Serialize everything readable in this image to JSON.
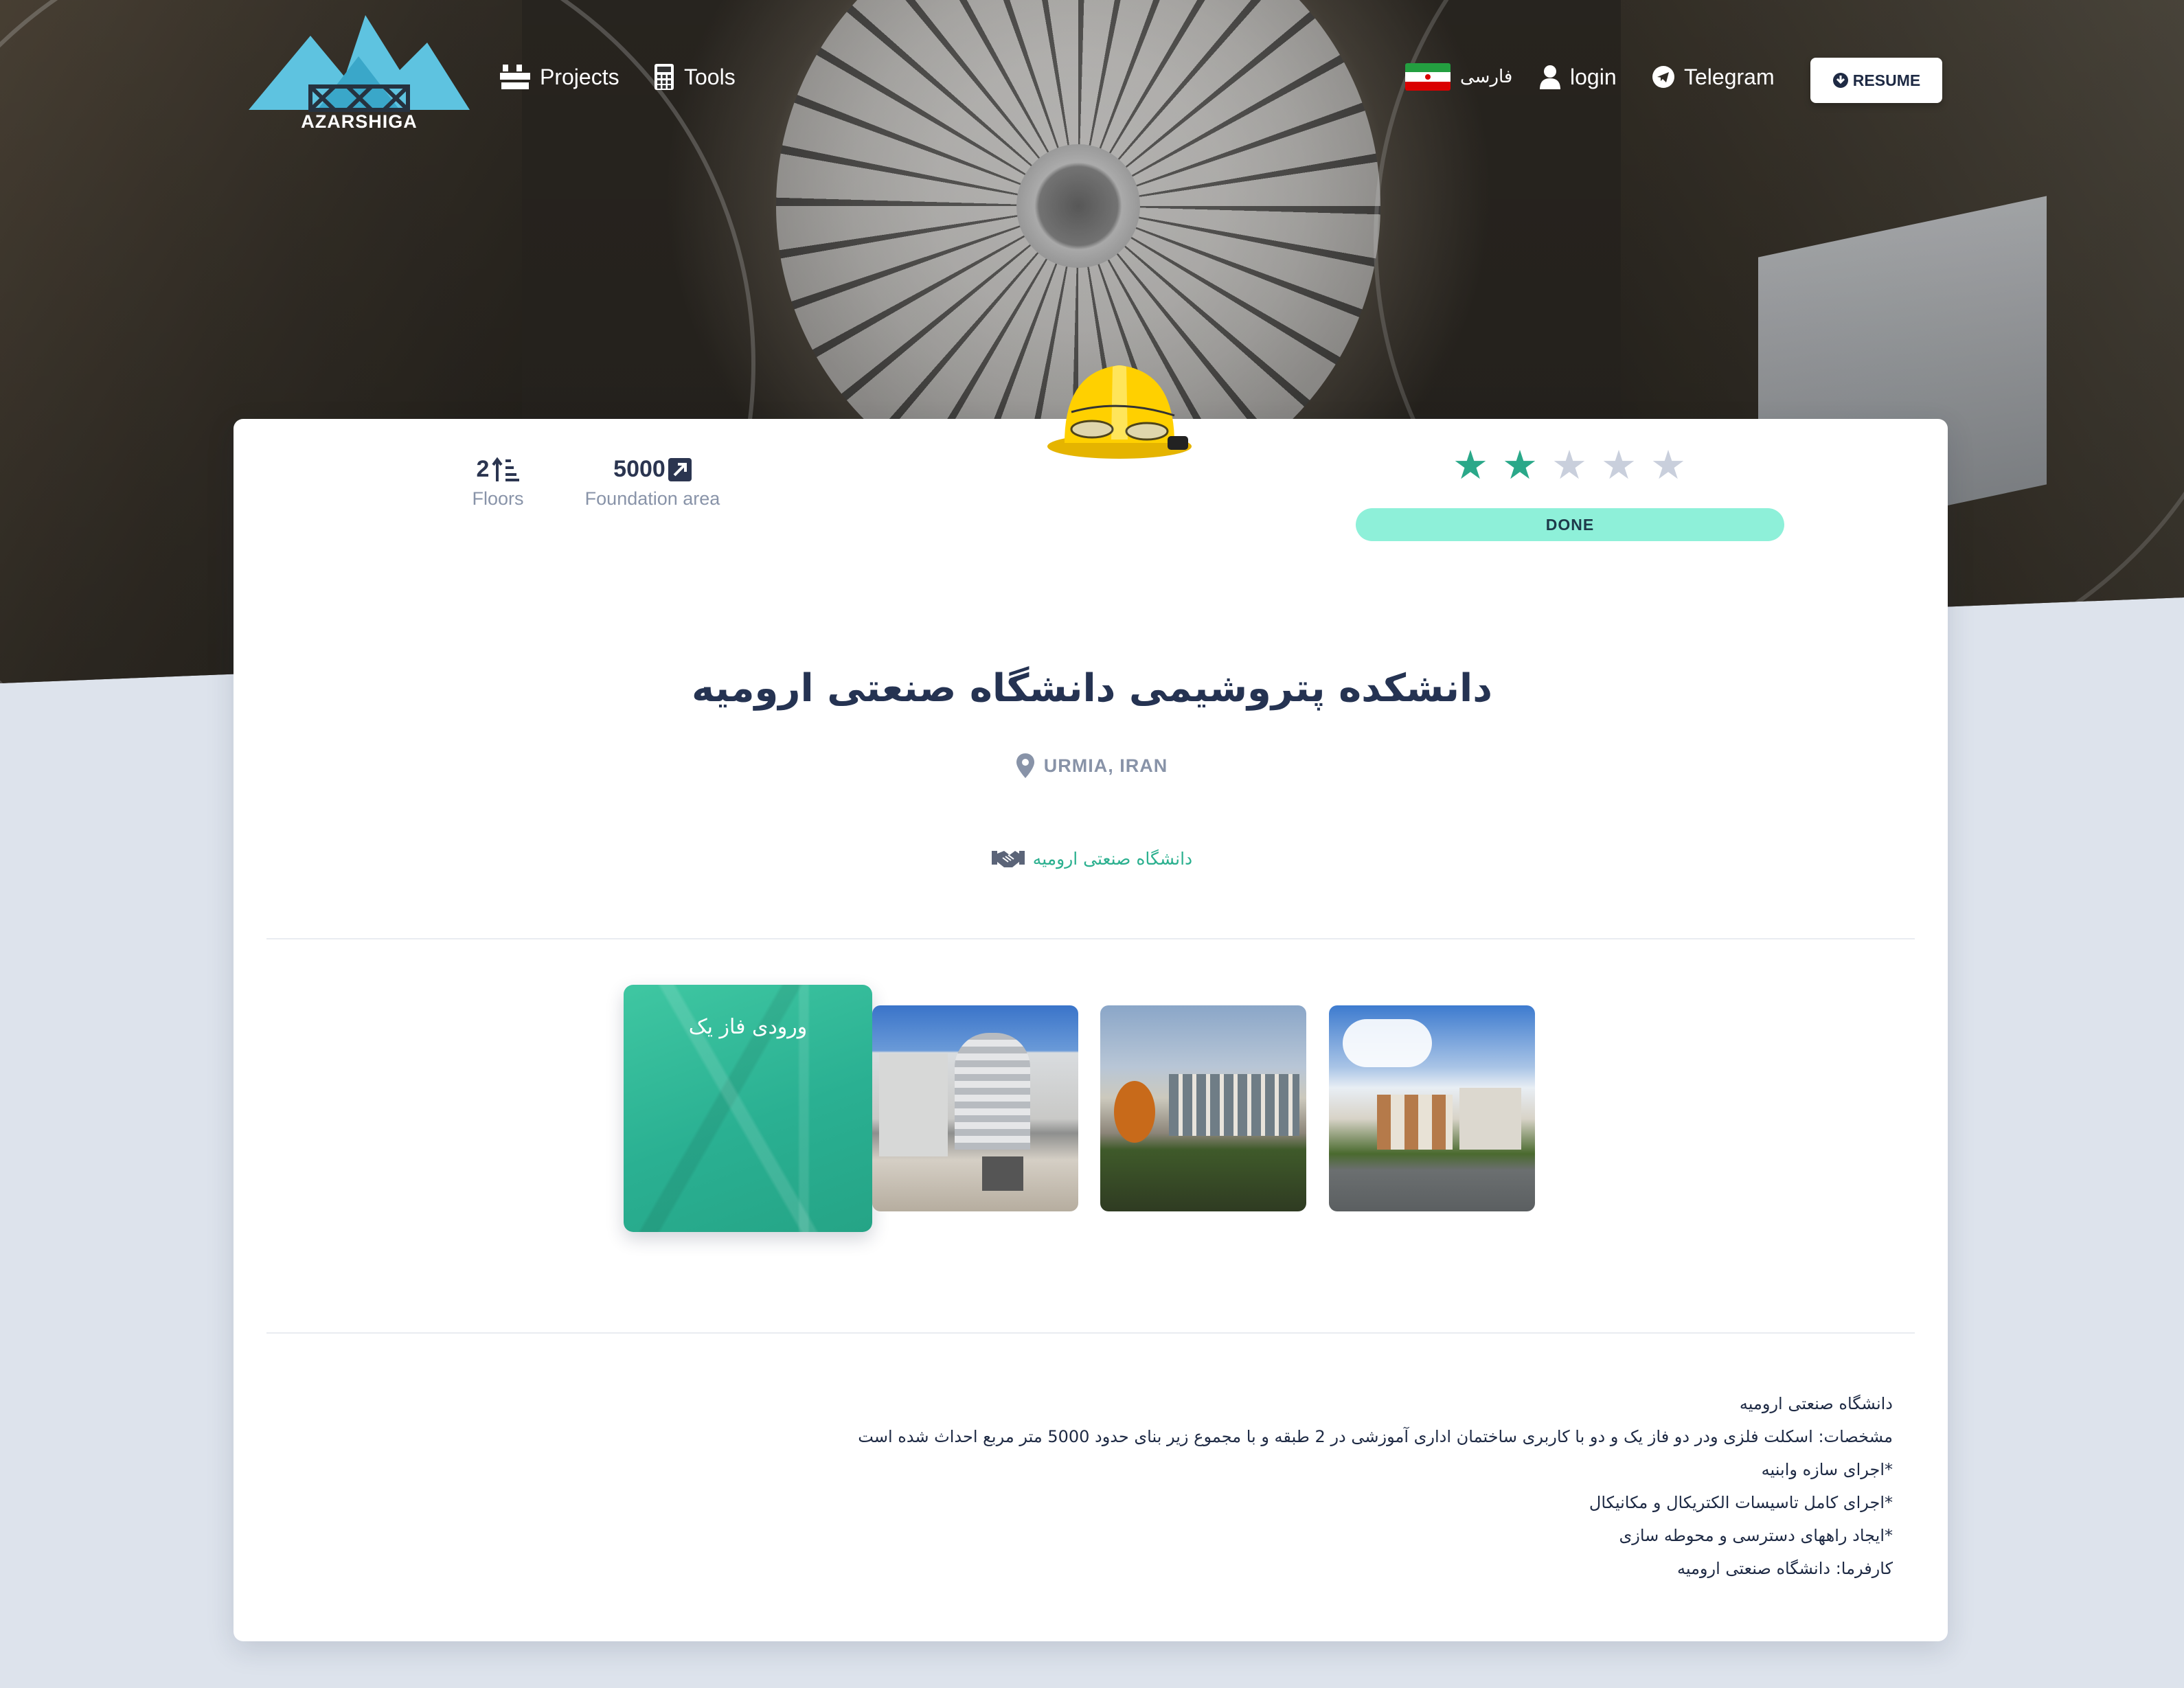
{
  "nav": {
    "brand": "AZARSHIGA",
    "items": [
      {
        "label": "Projects",
        "icon": "crane-icon"
      },
      {
        "label": "Tools",
        "icon": "calculator-icon"
      }
    ],
    "language": "فارسی",
    "login": "login",
    "telegram": "Telegram",
    "resume": "RESUME"
  },
  "stats": {
    "floors_value": "2",
    "floors_label": "Floors",
    "area_value": "5000",
    "area_label": "Foundation area"
  },
  "rating": {
    "value": 2,
    "max": 5,
    "filled_color": "#2aa889",
    "empty_color": "#c9cfdc"
  },
  "status": "DONE",
  "project": {
    "title": "دانشکده پتروشیمی دانشگاه صنعتی ارومیه",
    "location": "URMIA, IRAN",
    "client": "دانشگاه صنعتی ارومیه"
  },
  "gallery": {
    "main_caption": "ورودی فاز یک"
  },
  "description": {
    "lines": [
      "دانشگاه صنعتی ارومیه",
      "مشخصات: اسکلت فلزی ودر دو فاز یک و دو با کاربری ساختمان اداری آموزشی در 2 طبقه و با مجموع زیر بنای حدود 5000 متر مربع احداث شده است",
      "*اجرای سازه وابنیه",
      "*اجرای کامل تاسیسات الکتریکال و مکانیکال",
      "*ایجاد راههای دسترسی و محوطه سازی",
      "کارفرما: دانشگاه صنعتی ارومیه"
    ]
  },
  "colors": {
    "accent": "#2bb08f",
    "status_bg": "#8ef0d9",
    "page_bg": "#dde3ec",
    "logo": "#5ec3e0"
  }
}
